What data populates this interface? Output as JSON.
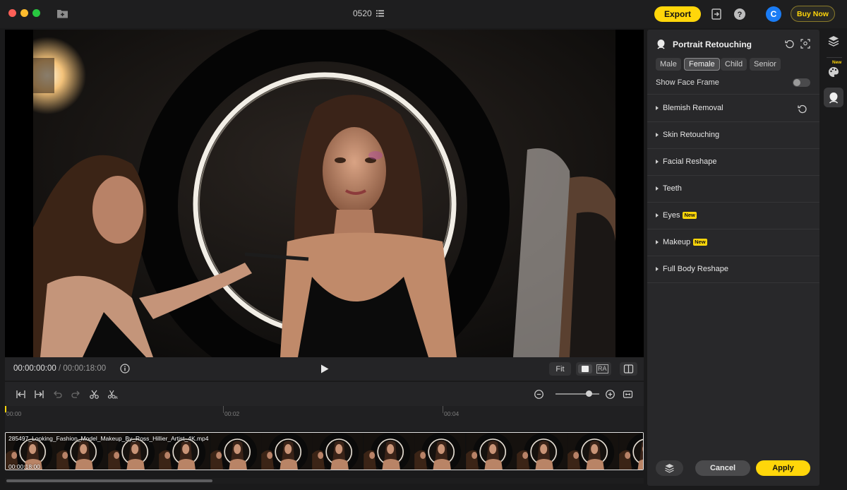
{
  "window": {
    "project_title": "0520",
    "export_label": "Export",
    "avatar_letter": "C",
    "buy_now_label": "Buy Now",
    "accent_color": "#ffd60a"
  },
  "player": {
    "current_time": "00:00:00:00",
    "separator": "/",
    "duration": "00:00:18:00",
    "fit_label": "Fit"
  },
  "timeline": {
    "ticks": [
      "00:00",
      "00:02",
      "00:04"
    ],
    "clip_name": "285497_Looking_Fashion_Model_Makeup_By_Ross_Hillier_Artist_4K.mp4",
    "clip_duration": "00:00:18:00"
  },
  "panel": {
    "title": "Portrait Retouching",
    "genders": [
      "Male",
      "Female",
      "Child",
      "Senior"
    ],
    "active_gender": "Female",
    "show_face_frame_label": "Show Face Frame",
    "show_face_frame_on": false,
    "sections": [
      {
        "label": "Blemish Removal",
        "new": ""
      },
      {
        "label": "Skin Retouching",
        "new": ""
      },
      {
        "label": "Facial Reshape",
        "new": ""
      },
      {
        "label": "Teeth",
        "new": ""
      },
      {
        "label": "Eyes",
        "new": "New"
      },
      {
        "label": "Makeup",
        "new": "New"
      },
      {
        "label": "Full Body Reshape",
        "new": ""
      }
    ],
    "cancel_label": "Cancel",
    "apply_label": "Apply"
  },
  "rail": {
    "new_badge": "New"
  }
}
